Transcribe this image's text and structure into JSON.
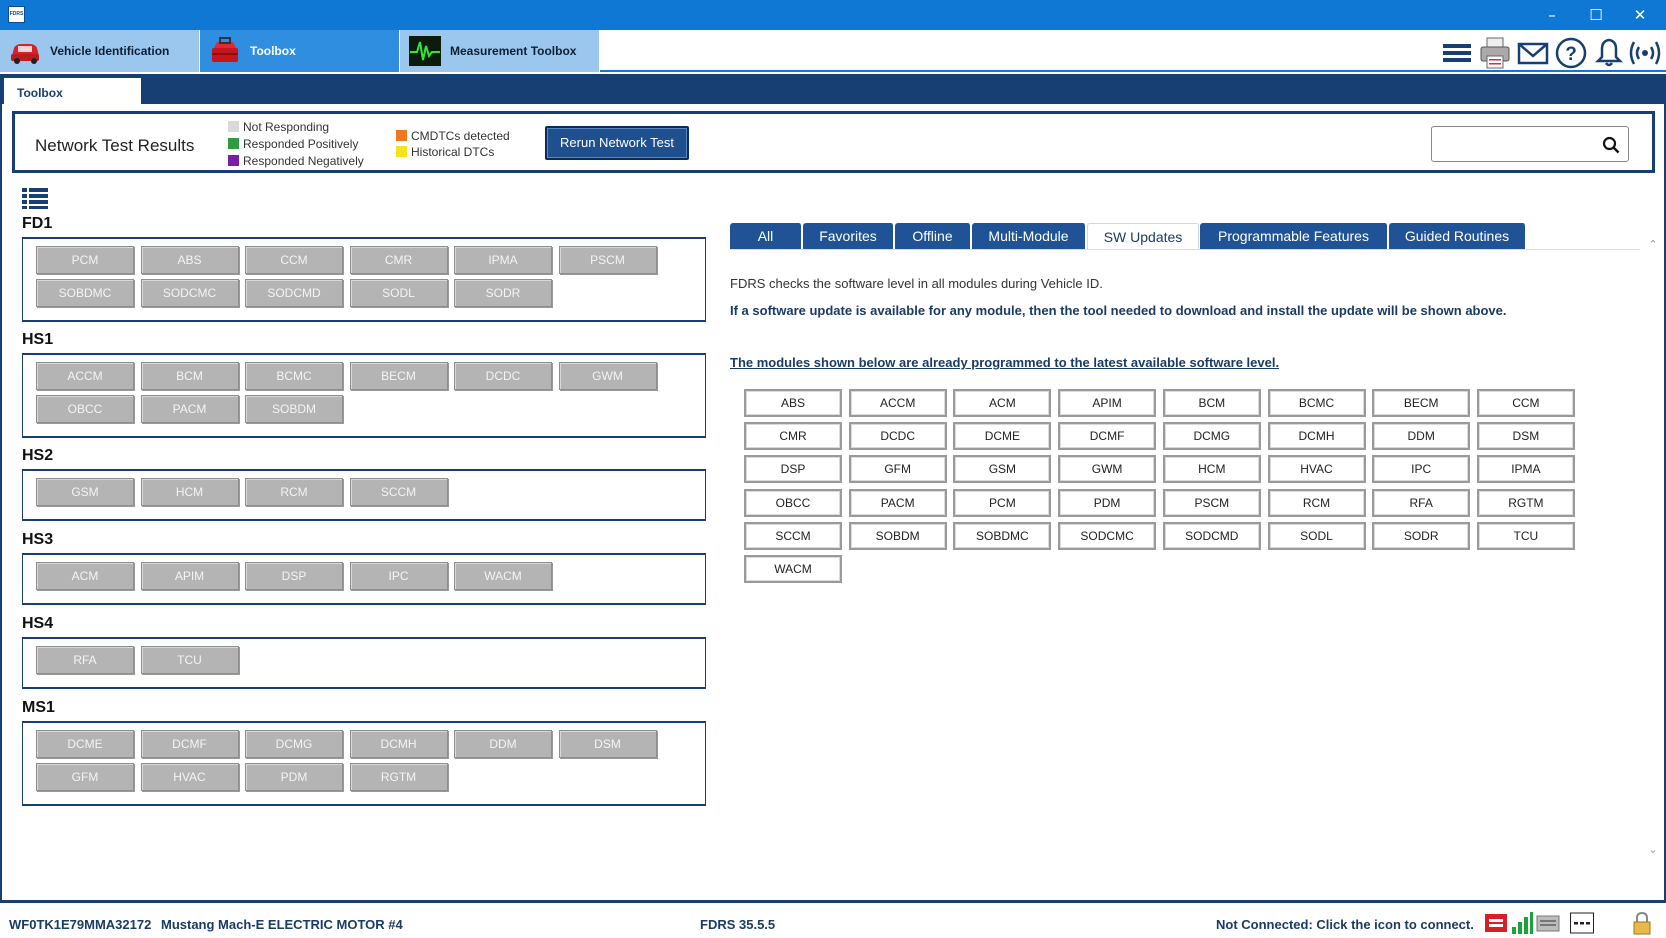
{
  "window": {
    "app_icon_text": "FDRS"
  },
  "app_tabs": [
    {
      "label": "Vehicle Identification"
    },
    {
      "label": "Toolbox"
    },
    {
      "label": "Measurement Toolbox"
    }
  ],
  "subtab": {
    "label": "Toolbox"
  },
  "network_test": {
    "title": "Network Test Results",
    "legend": [
      {
        "label": "Not Responding",
        "color": "#d9d9d9"
      },
      {
        "label": "Responded Positively",
        "color": "#2e9b3e"
      },
      {
        "label": "Responded Negatively",
        "color": "#7a1ea8"
      },
      {
        "label": "CMDTCs detected",
        "color": "#f07820"
      },
      {
        "label": "Historical DTCs",
        "color": "#f2e61a"
      }
    ],
    "rerun_label": "Rerun Network Test",
    "search_value": ""
  },
  "groups": [
    {
      "name": "FD1",
      "modules": [
        "PCM",
        "ABS",
        "CCM",
        "CMR",
        "IPMA",
        "PSCM",
        "SOBDMC",
        "SODCMC",
        "SODCMD",
        "SODL",
        "SODR"
      ]
    },
    {
      "name": "HS1",
      "modules": [
        "ACCM",
        "BCM",
        "BCMC",
        "BECM",
        "DCDC",
        "GWM",
        "OBCC",
        "PACM",
        "SOBDM"
      ]
    },
    {
      "name": "HS2",
      "modules": [
        "GSM",
        "HCM",
        "RCM",
        "SCCM"
      ]
    },
    {
      "name": "HS3",
      "modules": [
        "ACM",
        "APIM",
        "DSP",
        "IPC",
        "WACM"
      ]
    },
    {
      "name": "HS4",
      "modules": [
        "RFA",
        "TCU"
      ]
    },
    {
      "name": "MS1",
      "modules": [
        "DCME",
        "DCMF",
        "DCMG",
        "DCMH",
        "DDM",
        "DSM",
        "GFM",
        "HVAC",
        "PDM",
        "RGTM"
      ]
    }
  ],
  "module_status_color": "#b4b4b4",
  "right_tabs": [
    {
      "label": "All"
    },
    {
      "label": "Favorites"
    },
    {
      "label": "Offline"
    },
    {
      "label": "Multi-Module"
    },
    {
      "label": "SW Updates",
      "active": true
    },
    {
      "label": "Programmable Features"
    },
    {
      "label": "Guided Routines"
    }
  ],
  "sw_updates": {
    "info_line1": "FDRS checks the software level in all modules during Vehicle ID.",
    "info_line2": "If a software update is available for any module, then the tool needed to download and install the update will be shown above.",
    "programmed_heading": "The modules shown below are already programmed to the latest available software level.",
    "modules": [
      "ABS",
      "ACCM",
      "ACM",
      "APIM",
      "BCM",
      "BCMC",
      "BECM",
      "CCM",
      "CMR",
      "DCDC",
      "DCME",
      "DCMF",
      "DCMG",
      "DCMH",
      "DDM",
      "DSM",
      "DSP",
      "GFM",
      "GSM",
      "GWM",
      "HCM",
      "HVAC",
      "IPC",
      "IPMA",
      "OBCC",
      "PACM",
      "PCM",
      "PDM",
      "PSCM",
      "RCM",
      "RFA",
      "RGTM",
      "SCCM",
      "SOBDM",
      "SOBDMC",
      "SODCMC",
      "SODCMD",
      "SODL",
      "SODR",
      "TCU",
      "WACM"
    ]
  },
  "status_bar": {
    "vin": "WF0TK1E79MMA32172",
    "vehicle": "Mustang Mach-E ELECTRIC MOTOR #4",
    "version": "FDRS 35.5.5",
    "connection": "Not Connected: Click the icon to connect."
  }
}
